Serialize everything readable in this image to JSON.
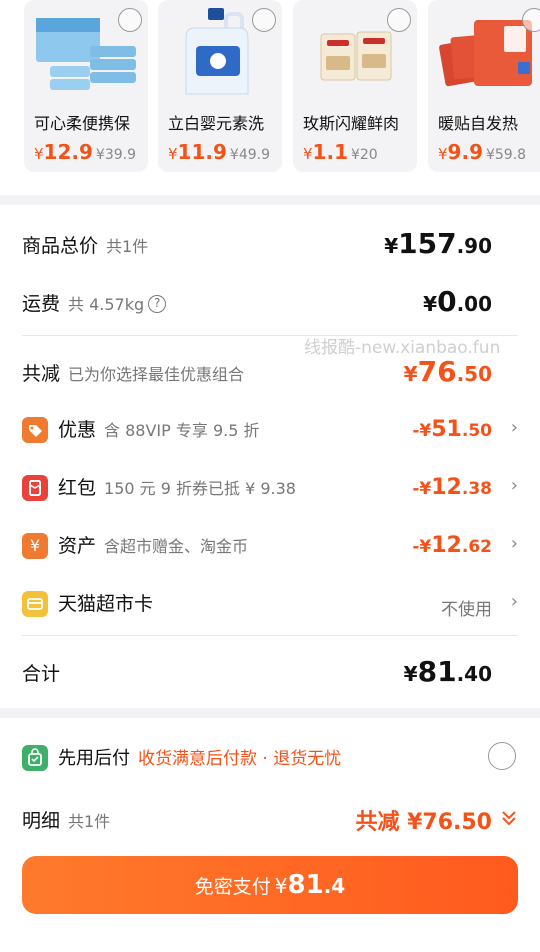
{
  "products": [
    {
      "name": "可心柔便携保",
      "price_int": "12",
      "price_dec": ".9",
      "orig": "¥39.9"
    },
    {
      "name": "立白婴元素洗",
      "price_int": "11",
      "price_dec": ".9",
      "orig": "¥49.9"
    },
    {
      "name": "玫斯闪耀鲜肉",
      "price_int": "1",
      "price_dec": ".1",
      "orig": "¥20"
    },
    {
      "name": "暖贴自发热",
      "price_int": "9",
      "price_dec": ".9",
      "orig": "¥59.8"
    }
  ],
  "summary": {
    "subtotal_label": "商品总价",
    "subtotal_count": "共1件",
    "subtotal_int": "157",
    "subtotal_dec": ".90",
    "shipping_label": "运费",
    "shipping_weight": "共 4.57kg",
    "shipping_int": "0",
    "shipping_dec": ".00",
    "watermark": "线报酷-new.xianbao.fun",
    "reduce_label": "共减",
    "reduce_desc": "已为你选择最佳优惠组合",
    "reduce_int": "76",
    "reduce_dec": ".50",
    "promo_label": "优惠",
    "promo_desc": "含 88VIP 专享 9.5 折",
    "promo_int": "51",
    "promo_dec": ".50",
    "redpack_label": "红包",
    "redpack_desc": "150 元 9 折券已抵 ¥ 9.38",
    "redpack_int": "12",
    "redpack_dec": ".38",
    "asset_label": "资产",
    "asset_desc": "含超市赠金、淘金币",
    "asset_int": "12",
    "asset_dec": ".62",
    "card_label": "天猫超市卡",
    "card_value": "不使用",
    "total_label": "合计",
    "total_int": "81",
    "total_dec": ".40"
  },
  "currency": "¥",
  "minus_currency": "-¥",
  "bottom": {
    "later_label": "先用后付",
    "later_desc": "收货满意后付款 · 退货无忧",
    "detail_label": "明细",
    "detail_count": "共1件",
    "detail_reduce": "共减 ¥76.50",
    "pay_label": "免密支付",
    "pay_int": "81",
    "pay_dec": ".4"
  },
  "colors": {
    "accent": "#f5521a",
    "pay_button": "#ff6a22",
    "promo_icon": "#f07a30",
    "redpack_icon": "#e8423a",
    "asset_icon": "#f07a30",
    "card_icon": "#f3c23b",
    "later_icon": "#3fb068"
  }
}
